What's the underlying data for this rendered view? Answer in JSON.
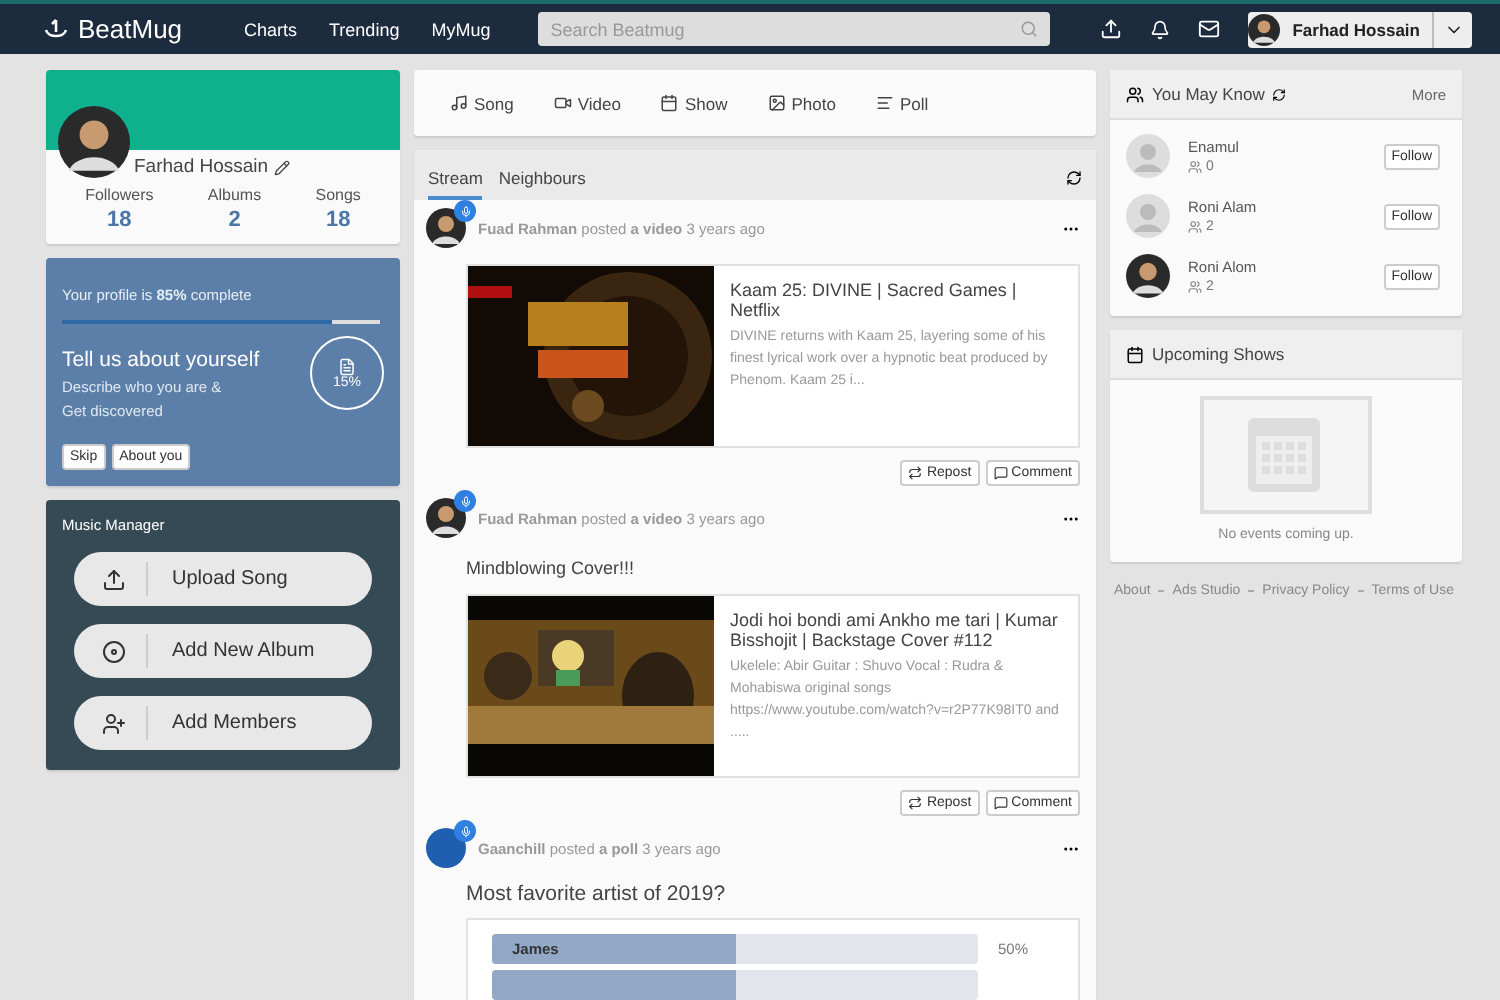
{
  "navbar": {
    "brand": "BeatMug",
    "links": [
      {
        "label": "Charts"
      },
      {
        "label": "Trending"
      },
      {
        "label": "MyMug"
      }
    ],
    "search": {
      "placeholder": "Search Beatmug"
    },
    "user": "Farhad Hossain"
  },
  "profile": {
    "name": "Farhad Hossain",
    "stats": [
      {
        "label": "Followers",
        "value": "18"
      },
      {
        "label": "Albums",
        "value": "2"
      },
      {
        "label": "Songs",
        "value": "18"
      }
    ]
  },
  "completion": {
    "prefix": "Your profile is ",
    "percent": "85%",
    "suffix": " complete",
    "level": 0.85,
    "title": "Tell us about yourself",
    "lines": [
      "Describe who you are &",
      "Get discovered"
    ],
    "remaining": "15%",
    "buttons": [
      "Skip",
      "About you"
    ]
  },
  "music_manager": {
    "title": "Music Manager",
    "actions": [
      {
        "kind": "upload",
        "label": "Upload Song"
      },
      {
        "kind": "album",
        "label": "Add New Album"
      },
      {
        "kind": "members",
        "label": "Add Members"
      }
    ]
  },
  "composer": [
    {
      "kind": "song",
      "label": "Song"
    },
    {
      "kind": "video",
      "label": "Video"
    },
    {
      "kind": "show",
      "label": "Show"
    },
    {
      "label": "Photo"
    },
    {
      "kind": "poll",
      "label": "Poll"
    }
  ],
  "feed_tabs": [
    {
      "label": "Stream",
      "selected": true
    },
    {
      "label": "Neighbours",
      "selected": false
    }
  ],
  "posts": [
    {
      "kind": "video",
      "author": "Fuad Rahman",
      "verb": "posted",
      "object": "a video",
      "time": "3 years ago",
      "title": "Kaam 25: DIVINE | Sacred Games | Netflix",
      "description": "DIVINE returns with Kaam 25, layering some of his finest lyrical work over a hypnotic beat produced by Phenom. Kaam 25 i...",
      "actions": [
        "Repost",
        "Comment"
      ]
    },
    {
      "kind": "video",
      "author": "Fuad Rahman",
      "verb": "posted",
      "object": "a video",
      "time": "3 years ago",
      "text": "Mindblowing Cover!!!",
      "title": "Jodi hoi bondi ami Ankho me tari | Kumar Bisshojit | Backstage Cover #112",
      "description": "Ukelele: Abir Guitar : Shuvo Vocal : Rudra & Mohabiswa original songs https://www.youtube.com/watch?v=r2P77K98IT0 and .....",
      "actions": [
        "Repost",
        "Comment"
      ]
    },
    {
      "kind": "poll",
      "author": "Gaanchill",
      "verb": "posted",
      "object": "a poll",
      "time": "3 years ago",
      "text": "Most favorite artist of 2019?",
      "options": [
        {
          "label": "James",
          "level": 0.5,
          "reading": "50%"
        },
        {
          "level": 0.5
        }
      ]
    }
  ],
  "people": {
    "title": "You May Know",
    "more": "More",
    "items": [
      {
        "name": "Enamul",
        "count": "0",
        "kind": "blank",
        "button": "Follow"
      },
      {
        "name": "Roni Alam",
        "count": "2",
        "kind": "blank",
        "button": "Follow"
      },
      {
        "name": "Roni Alom",
        "count": "2",
        "button": "Follow"
      }
    ]
  },
  "shows": {
    "title": "Upcoming Shows",
    "empty": "No events coming up."
  },
  "footer": [
    "About",
    "Ads Studio",
    "Privacy Policy",
    "Terms of Use"
  ]
}
